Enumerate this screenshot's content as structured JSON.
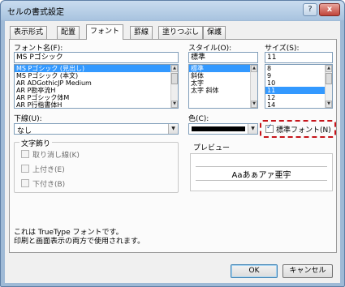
{
  "window": {
    "title": "セルの書式設定",
    "help_glyph": "?",
    "close_glyph": "x"
  },
  "tabs": [
    {
      "label": "表示形式"
    },
    {
      "label": "配置"
    },
    {
      "label": "フォント"
    },
    {
      "label": "罫線"
    },
    {
      "label": "塗りつぶし"
    },
    {
      "label": "保護"
    }
  ],
  "active_tab": "フォント",
  "font": {
    "label": "フォント名(F):",
    "value": "MS Pゴシック",
    "list": [
      "MS Pゴシック (見出し)",
      "MS Pゴシック (本文)",
      "AR ADGothicJP Medium",
      "AR P勘亭流H",
      "AR Pゴシック体M",
      "AR P行楷書体H"
    ],
    "selected_index": 0
  },
  "style": {
    "label": "スタイル(O):",
    "value": "標準",
    "list": [
      "標準",
      "斜体",
      "太字",
      "太字 斜体"
    ],
    "selected_index": 0
  },
  "size": {
    "label": "サイズ(S):",
    "value": "11",
    "list": [
      "8",
      "9",
      "10",
      "11",
      "12",
      "14"
    ],
    "selected_index": 3
  },
  "underline": {
    "label": "下線(U):",
    "value": "なし"
  },
  "color": {
    "label": "色(C):",
    "swatch": "#000000"
  },
  "normal_font": {
    "label": "標準フォント(N)",
    "checked": true
  },
  "effects": {
    "title": "文字飾り",
    "items": [
      {
        "label": "取り消し線(K)",
        "checked": false
      },
      {
        "label": "上付き(E)",
        "checked": false
      },
      {
        "label": "下付き(B)",
        "checked": false
      }
    ]
  },
  "preview": {
    "title": "プレビュー",
    "sample": "Aaあぁアァ亜宇"
  },
  "note": {
    "line1": "これは TrueType フォントです。",
    "line2": "印刷と画面表示の両方で使用されます。"
  },
  "buttons": {
    "ok": "OK",
    "cancel": "キャンセル"
  },
  "colors": {
    "selection": "#3399ff",
    "highlight_outline": "#c6141a"
  }
}
